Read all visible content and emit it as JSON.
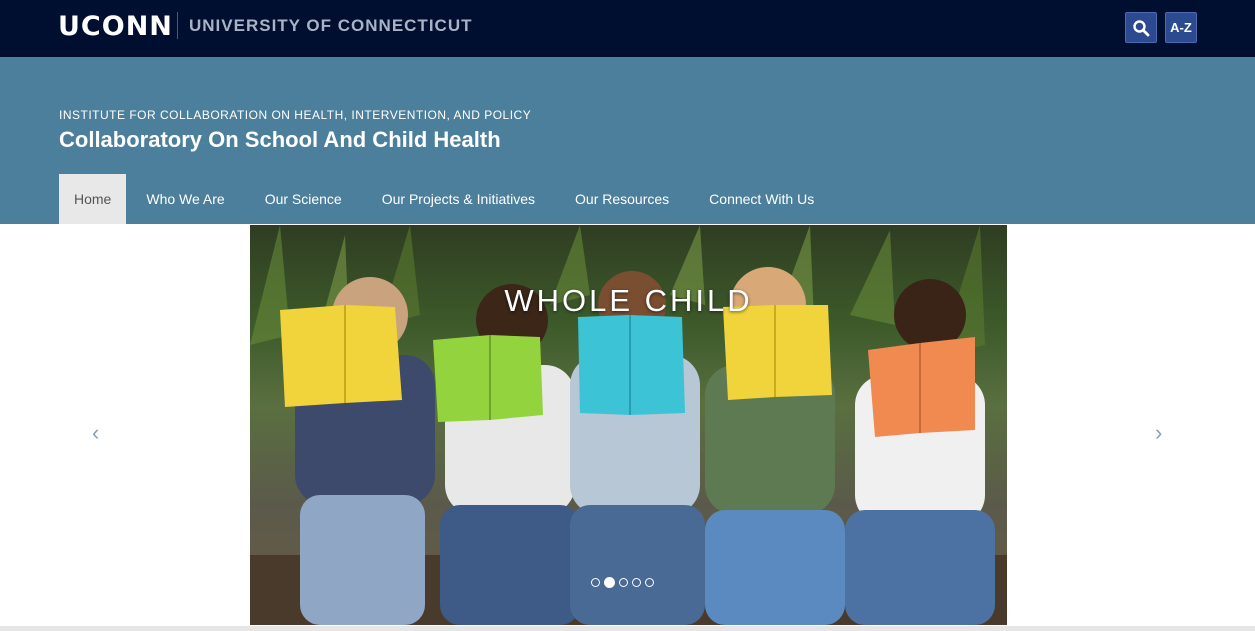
{
  "topbar": {
    "logo": "UCONN",
    "university": "UNIVERSITY OF CONNECTICUT",
    "search_icon": "search-icon",
    "az_label": "A-Z"
  },
  "header": {
    "institute": "INSTITUTE FOR COLLABORATION ON HEALTH, INTERVENTION, AND POLICY",
    "title": "Collaboratory On School And Child Health"
  },
  "nav": {
    "items": [
      {
        "label": "Home",
        "active": true
      },
      {
        "label": "Who We Are"
      },
      {
        "label": "Our Science"
      },
      {
        "label": "Our Projects & Initiatives"
      },
      {
        "label": "Our Resources"
      },
      {
        "label": "Connect With Us"
      }
    ]
  },
  "carousel": {
    "caption": "WHOLE CHILD",
    "prev_label": "‹",
    "next_label": "›",
    "active_slide": 2,
    "slide_count": 5
  },
  "colors": {
    "topbar": "#000e2f",
    "header": "#4c7f9b",
    "button": "#2c4a8f"
  }
}
